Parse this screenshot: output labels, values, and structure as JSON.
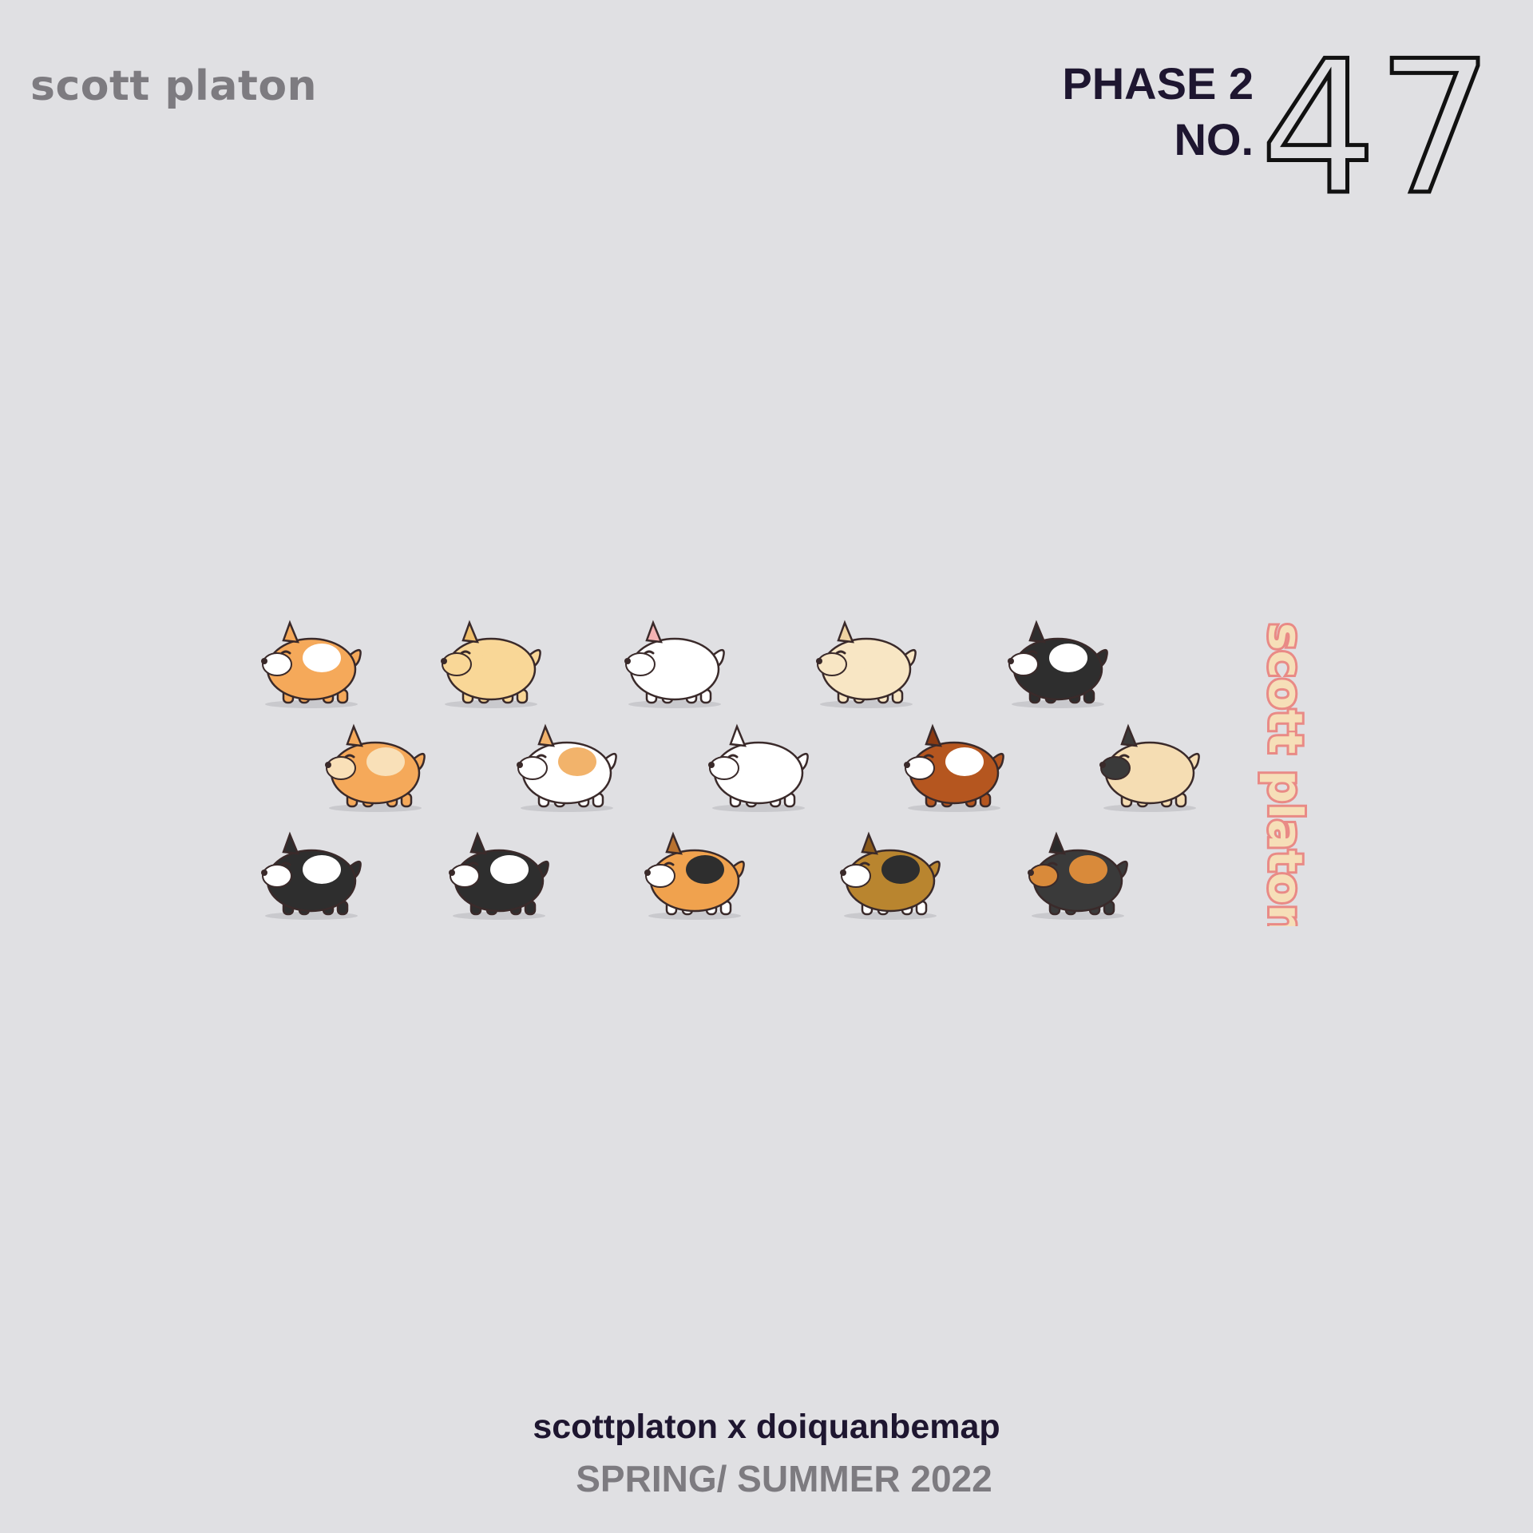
{
  "brand": "scott platon",
  "phase_label": "PHASE 2",
  "number_label": "NO.",
  "number": "47",
  "vertical_brand": "scott platon",
  "collab": "scottplaton x doiquanbemap",
  "season": "SPRING/ SUMMER 2022",
  "colors": {
    "background": "#e0e0e3",
    "brand_text": "#7d7b80",
    "dark_text": "#1e1630",
    "vertical_outline": "#e98a86",
    "vertical_fill": "#f6dfb8"
  },
  "dogs": [
    {
      "name": "corgi",
      "body": "#f5a95a",
      "ear": "#f5a95a",
      "patch": "#ffffff",
      "muzzle": "#ffffff"
    },
    {
      "name": "golden-retriever",
      "body": "#f9d797",
      "ear": "#efbf6c",
      "patch": "#f9d797",
      "muzzle": "#f9d797"
    },
    {
      "name": "bull-terrier",
      "body": "#ffffff",
      "ear": "#f4b3b3",
      "patch": "#ffffff",
      "muzzle": "#ffffff"
    },
    {
      "name": "labrador",
      "body": "#f8e6c4",
      "ear": "#eed3a2",
      "patch": "#f8e6c4",
      "muzzle": "#f8e6c4"
    },
    {
      "name": "border-collie",
      "body": "#2e2e2e",
      "ear": "#2e2e2e",
      "patch": "#ffffff",
      "muzzle": "#ffffff"
    },
    {
      "name": "shiba",
      "body": "#f5a95a",
      "ear": "#f5a95a",
      "patch": "#f9e0b8",
      "muzzle": "#f9e0b8"
    },
    {
      "name": "jack-russell",
      "body": "#ffffff",
      "ear": "#f2b36b",
      "patch": "#f2b36b",
      "muzzle": "#ffffff"
    },
    {
      "name": "samoyed",
      "body": "#ffffff",
      "ear": "#ffffff",
      "patch": "#ffffff",
      "muzzle": "#ffffff"
    },
    {
      "name": "saint-bernard",
      "body": "#b5561f",
      "ear": "#8a3a12",
      "patch": "#ffffff",
      "muzzle": "#ffffff"
    },
    {
      "name": "pug",
      "body": "#f5ddb3",
      "ear": "#3a3a3a",
      "patch": "#f5ddb3",
      "muzzle": "#3a3a3a"
    },
    {
      "name": "husky",
      "body": "#2e2e2e",
      "ear": "#2e2e2e",
      "patch": "#ffffff",
      "muzzle": "#ffffff"
    },
    {
      "name": "boston-terrier",
      "body": "#2e2e2e",
      "ear": "#2e2e2e",
      "patch": "#ffffff",
      "muzzle": "#ffffff"
    },
    {
      "name": "beagle",
      "body": "#f0a24e",
      "ear": "#b9722f",
      "patch": "#2e2e2e",
      "muzzle": "#ffffff"
    },
    {
      "name": "basset-hound",
      "body": "#b9852f",
      "ear": "#8a5a1a",
      "patch": "#2e2e2e",
      "muzzle": "#ffffff"
    },
    {
      "name": "rottweiler",
      "body": "#3a3a3a",
      "ear": "#2a2a2a",
      "patch": "#d98a3a",
      "muzzle": "#d98a3a"
    }
  ]
}
